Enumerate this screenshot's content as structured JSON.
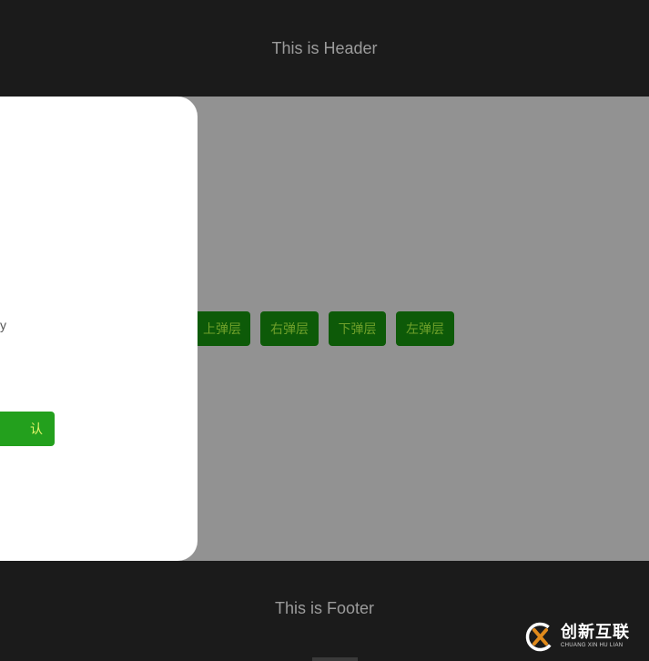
{
  "header": {
    "title": "This is Header"
  },
  "footer": {
    "title": "This is Footer"
  },
  "buttons": [
    {
      "label": "上弹层",
      "name": "popup-top-button"
    },
    {
      "label": "右弹层",
      "name": "popup-right-button"
    },
    {
      "label": "下弹层",
      "name": "popup-bottom-button"
    },
    {
      "label": "左弹层",
      "name": "popup-left-button"
    }
  ],
  "panel": {
    "partial_text": "y",
    "confirm_label": "认"
  },
  "watermark": {
    "title": "创新互联",
    "subtitle": "CHUANG XIN HU LIAN"
  },
  "colors": {
    "header_bg": "#1b1b1b",
    "overlay_bg": "#929292",
    "button_bg": "#0d5a08",
    "button_text": "#6fa02a",
    "confirm_bg": "#23a01d",
    "confirm_text": "#e6f56a",
    "panel_bg": "#ffffff"
  }
}
